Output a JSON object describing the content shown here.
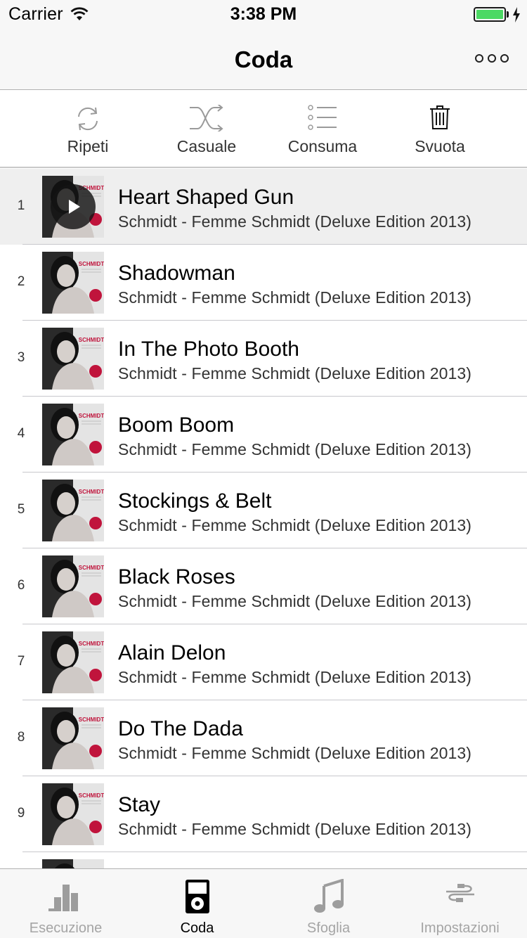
{
  "status_bar": {
    "carrier": "Carrier",
    "time": "3:38 PM",
    "battery_level": 1.0,
    "battery_color": "#4cd964"
  },
  "nav": {
    "title": "Coda",
    "more_icon": "ellipsis-circles-icon"
  },
  "toolbar": {
    "items": [
      {
        "label": "Ripeti",
        "icon": "repeat-icon"
      },
      {
        "label": "Casuale",
        "icon": "shuffle-icon"
      },
      {
        "label": "Consuma",
        "icon": "list-icon"
      },
      {
        "label": "Svuota",
        "icon": "trash-icon"
      }
    ]
  },
  "queue": {
    "current_index": 1,
    "rows": [
      {
        "number": "1",
        "title": "Heart Shaped Gun",
        "subtitle": "Schmidt - Femme Schmidt (Deluxe Edition 2013)"
      },
      {
        "number": "2",
        "title": "Shadowman",
        "subtitle": "Schmidt - Femme Schmidt (Deluxe Edition 2013)"
      },
      {
        "number": "3",
        "title": "In The Photo Booth",
        "subtitle": "Schmidt - Femme Schmidt (Deluxe Edition 2013)"
      },
      {
        "number": "4",
        "title": "Boom Boom",
        "subtitle": "Schmidt - Femme Schmidt (Deluxe Edition 2013)"
      },
      {
        "number": "5",
        "title": "Stockings & Belt",
        "subtitle": "Schmidt - Femme Schmidt (Deluxe Edition 2013)"
      },
      {
        "number": "6",
        "title": "Black Roses",
        "subtitle": "Schmidt - Femme Schmidt (Deluxe Edition 2013)"
      },
      {
        "number": "7",
        "title": "Alain Delon",
        "subtitle": "Schmidt - Femme Schmidt (Deluxe Edition 2013)"
      },
      {
        "number": "8",
        "title": "Do The Dada",
        "subtitle": "Schmidt - Femme Schmidt (Deluxe Edition 2013)"
      },
      {
        "number": "9",
        "title": "Stay",
        "subtitle": "Schmidt - Femme Schmidt (Deluxe Edition 2013)"
      },
      {
        "number": "",
        "title": "",
        "subtitle": ""
      }
    ],
    "album_art_text": "SCHMIDT"
  },
  "tab_bar": {
    "active": "Coda",
    "tabs": [
      {
        "label": "Esecuzione",
        "icon": "equalizer-bars-icon"
      },
      {
        "label": "Coda",
        "icon": "ipod-icon"
      },
      {
        "label": "Sfoglia",
        "icon": "music-note-icon"
      },
      {
        "label": "Impostazioni",
        "icon": "cable-plug-icon"
      }
    ]
  }
}
